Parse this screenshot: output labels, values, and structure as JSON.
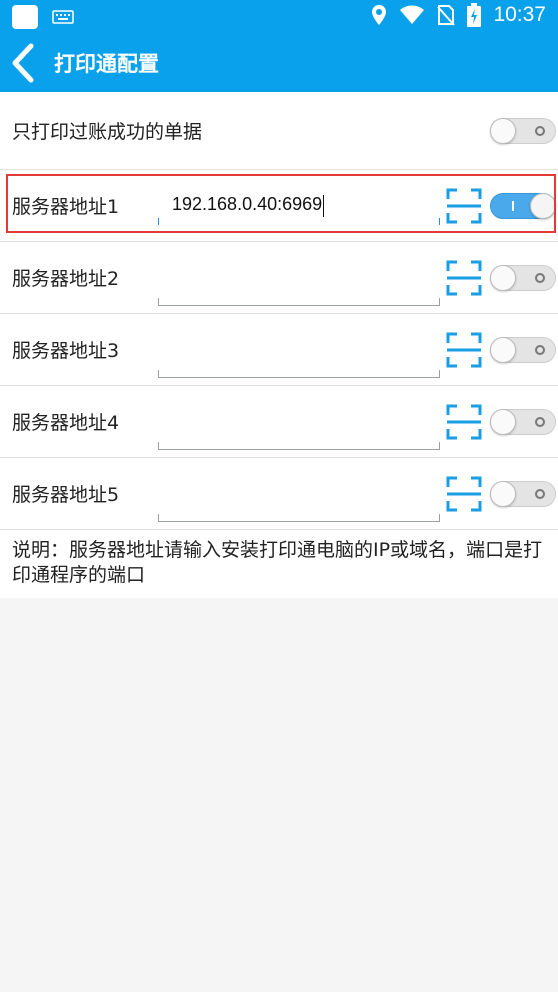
{
  "status_bar": {
    "time": "10:37",
    "icons": [
      "app-square-icon",
      "keyboard-icon",
      "location-pin-icon",
      "wifi-icon",
      "no-sim-icon",
      "battery-charging-icon"
    ]
  },
  "app_bar": {
    "title": "打印通配置",
    "back_icon": "chevron-left-icon"
  },
  "only_posted": {
    "label": "只打印过账成功的单据",
    "enabled": false
  },
  "servers": [
    {
      "label": "服务器地址1",
      "value": "192.168.0.40:6969",
      "enabled": true,
      "focused": true
    },
    {
      "label": "服务器地址2",
      "value": "",
      "enabled": false
    },
    {
      "label": "服务器地址3",
      "value": "",
      "enabled": false
    },
    {
      "label": "服务器地址4",
      "value": "",
      "enabled": false
    },
    {
      "label": "服务器地址5",
      "value": "",
      "enabled": false
    }
  ],
  "note": "说明：服务器地址请输入安装打印通电脑的IP或域名，端口是打印通程序的端口",
  "colors": {
    "primary": "#0aa1ec",
    "accent": "#4aa9ea",
    "highlight": "#e53935"
  }
}
